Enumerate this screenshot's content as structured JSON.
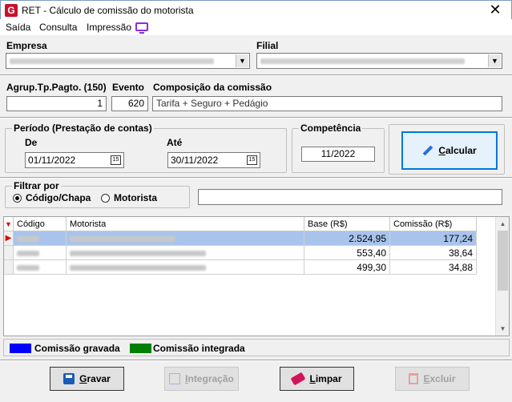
{
  "window": {
    "title": "RET - Cálculo de comissão do motorista",
    "app_icon_letter": "G",
    "close_glyph": "✕"
  },
  "menu": {
    "items": [
      "Saída",
      "Consulta",
      "Impressão"
    ],
    "icon": "tv-icon"
  },
  "empresa": {
    "label": "Empresa"
  },
  "filial": {
    "label": "Filial"
  },
  "agrup": {
    "label": "Agrup.Tp.Pagto. (150)",
    "value": "1"
  },
  "evento": {
    "label": "Evento",
    "value": "620"
  },
  "composicao": {
    "label": "Composição da comissão",
    "value": "Tarifa + Seguro + Pedágio"
  },
  "periodo": {
    "label": "Período (Prestação de contas)",
    "de_label": "De",
    "de_value": "01/11/2022",
    "ate_label": "Até",
    "ate_value": "30/11/2022",
    "cal_glyph": "15"
  },
  "competencia": {
    "label": "Competência",
    "value": "11/2022"
  },
  "calcular": {
    "label_prefix": "",
    "label_underlined": "C",
    "label_rest": "alcular"
  },
  "filtro": {
    "label": "Filtrar por",
    "options": [
      "Código/Chapa",
      "Motorista"
    ],
    "selected": "Código/Chapa"
  },
  "grid": {
    "columns": [
      "Código",
      "Motorista",
      "Base (R$)",
      "Comissão (R$)"
    ],
    "rows": [
      {
        "base": "2.524,95",
        "comissao": "177,24",
        "selected": true
      },
      {
        "base": "553,40",
        "comissao": "38,64",
        "selected": false
      },
      {
        "base": "499,30",
        "comissao": "34,88",
        "selected": false
      }
    ]
  },
  "legend": {
    "items": [
      {
        "label": "Comissão gravada",
        "color": "#0000ff"
      },
      {
        "label": "Comissão integrada",
        "color": "#008000"
      }
    ]
  },
  "buttons": {
    "gravar": {
      "u": "G",
      "rest": "ravar"
    },
    "integracao": {
      "u": "I",
      "rest": "ntegração"
    },
    "limpar": {
      "u": "L",
      "rest": "impar"
    },
    "excluir": {
      "u": "E",
      "rest": "xcluir"
    }
  },
  "colors": {
    "selected_row": "#a8c4ec",
    "title_border": "#7a9cc4",
    "accent": "#0078d7"
  }
}
